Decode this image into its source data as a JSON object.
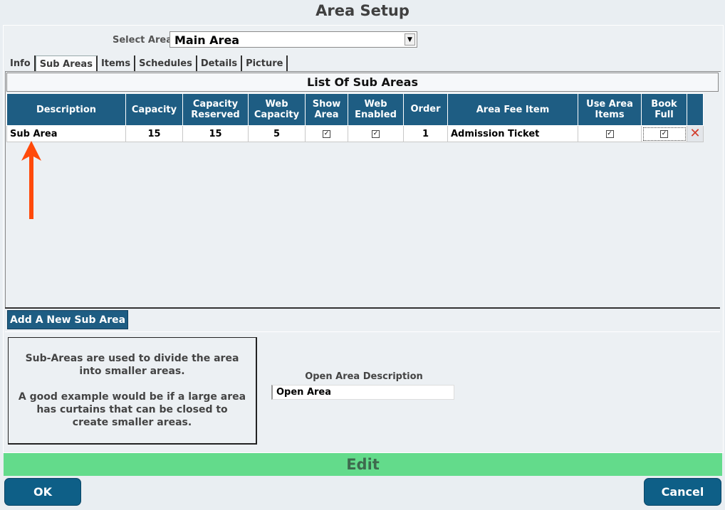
{
  "window": {
    "title": "Area Setup"
  },
  "select_area": {
    "label": "Select Area",
    "value": "Main Area"
  },
  "tabs": [
    {
      "label": "Info"
    },
    {
      "label": "Sub Areas",
      "active": true
    },
    {
      "label": "Items"
    },
    {
      "label": "Schedules"
    },
    {
      "label": "Details"
    },
    {
      "label": "Picture"
    }
  ],
  "list": {
    "title": "List Of Sub Areas",
    "columns": {
      "description": "Description",
      "capacity": "Capacity",
      "capacity_reserved_1": "Capacity",
      "capacity_reserved_2": "Reserved",
      "web_capacity_1": "Web",
      "web_capacity_2": "Capacity",
      "show_area_1": "Show",
      "show_area_2": "Area",
      "web_enabled_1": "Web",
      "web_enabled_2": "Enabled",
      "order": "Order",
      "order_sort_glyph": "△",
      "area_fee_item": "Area Fee Item",
      "use_area_items_1": "Use Area",
      "use_area_items_2": "Items",
      "book_full_1": "Book",
      "book_full_2": "Full"
    },
    "rows": [
      {
        "description": "Sub Area",
        "capacity": "15",
        "capacity_reserved": "15",
        "web_capacity": "5",
        "show_area": true,
        "web_enabled": true,
        "order": "1",
        "area_fee_item": "Admission Ticket",
        "use_area_items": true,
        "book_full": true,
        "delete_icon": "✕"
      }
    ]
  },
  "check_glyph": "✓",
  "add_button": {
    "label": "Add A New Sub Area"
  },
  "info": {
    "paragraph1": "Sub-Areas are used to divide the area into smaller areas.",
    "paragraph2": "A good example would be if a large area has curtains that can be closed to create smaller areas."
  },
  "open_area": {
    "label": "Open Area Description",
    "value": "Open Area"
  },
  "mode_bar": {
    "label": "Edit"
  },
  "footer": {
    "ok_label": "OK",
    "cancel_label": "Cancel"
  },
  "colors": {
    "header_blue": "#1e5d83",
    "edit_green": "#63db8b",
    "button_blue": "#0e5f87",
    "annotation_arrow": "#ff4a0a",
    "delete_red": "#d23a2a"
  }
}
